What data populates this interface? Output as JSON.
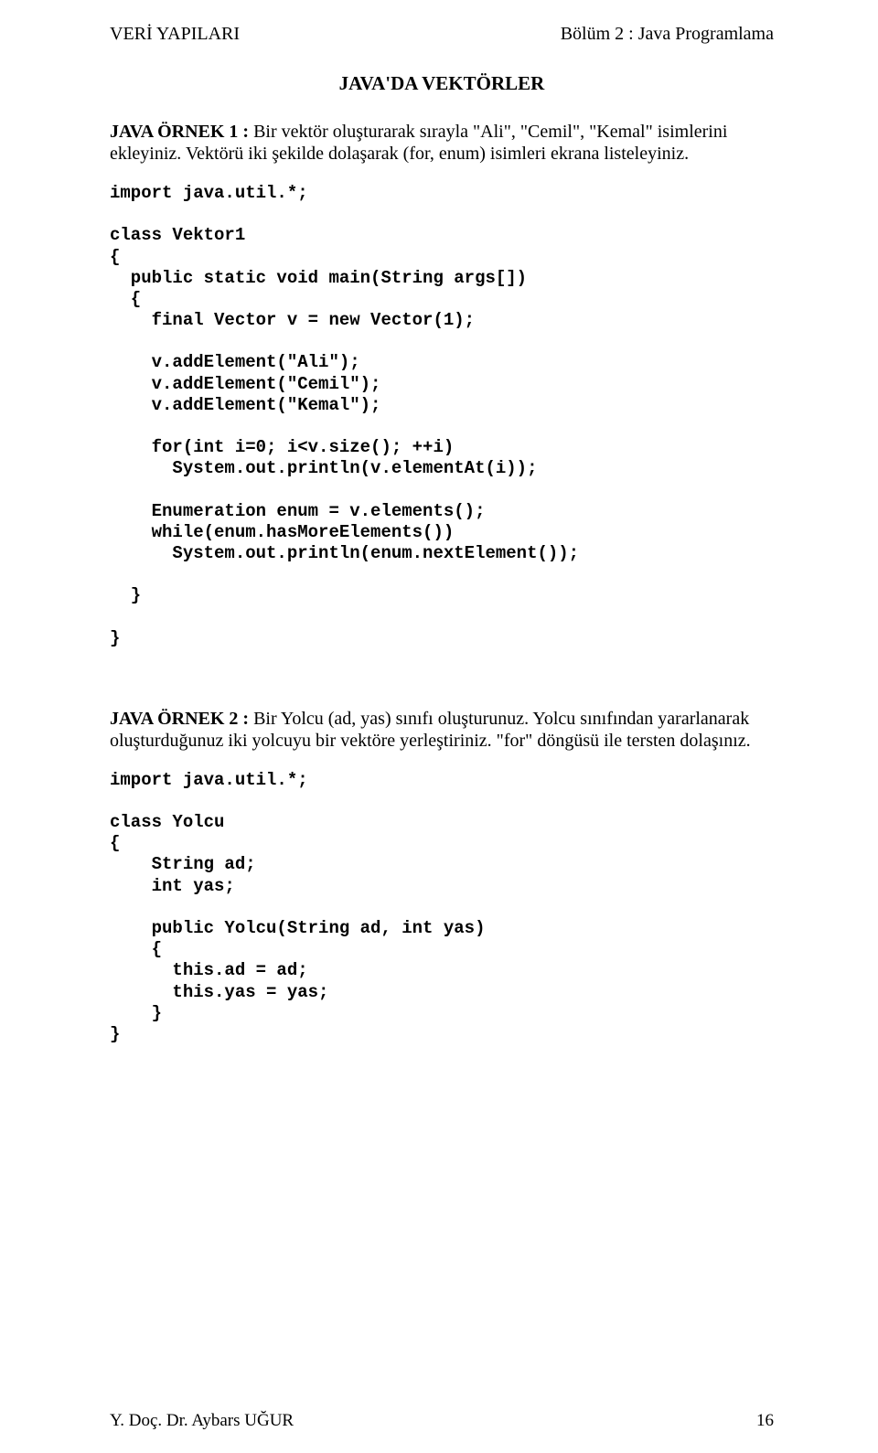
{
  "header": {
    "left": "VERİ YAPILARI",
    "right": "Bölüm 2 : Java Programlama"
  },
  "title": "JAVA'DA VEKTÖRLER",
  "ex1": {
    "lead": "JAVA ÖRNEK 1 : ",
    "body": "Bir vektör oluşturarak sırayla \"Ali\", \"Cemil\", \"Kemal\" isimlerini ekleyiniz. Vektörü iki şekilde dolaşarak (for, enum) isimleri ekrana listeleyiniz."
  },
  "code1": "import java.util.*;\n\nclass Vektor1\n{\n  public static void main(String args[])\n  {\n    final Vector v = new Vector(1);\n\n    v.addElement(\"Ali\");\n    v.addElement(\"Cemil\");\n    v.addElement(\"Kemal\");\n\n    for(int i=0; i<v.size(); ++i)\n      System.out.println(v.elementAt(i));\n\n    Enumeration enum = v.elements();\n    while(enum.hasMoreElements())\n      System.out.println(enum.nextElement());\n\n  }\n\n}",
  "ex2": {
    "lead": "JAVA ÖRNEK 2 : ",
    "body": "Bir Yolcu (ad, yas) sınıfı oluşturunuz. Yolcu sınıfından yararlanarak oluşturduğunuz iki yolcuyu bir vektöre yerleştiriniz. \"for\" döngüsü ile tersten dolaşınız."
  },
  "code2": "import java.util.*;\n\nclass Yolcu\n{\n    String ad;\n    int yas;\n\n    public Yolcu(String ad, int yas)\n    {\n      this.ad = ad;\n      this.yas = yas;\n    }\n}",
  "footer": {
    "left": "Y. Doç. Dr. Aybars UĞUR",
    "right": "16"
  }
}
